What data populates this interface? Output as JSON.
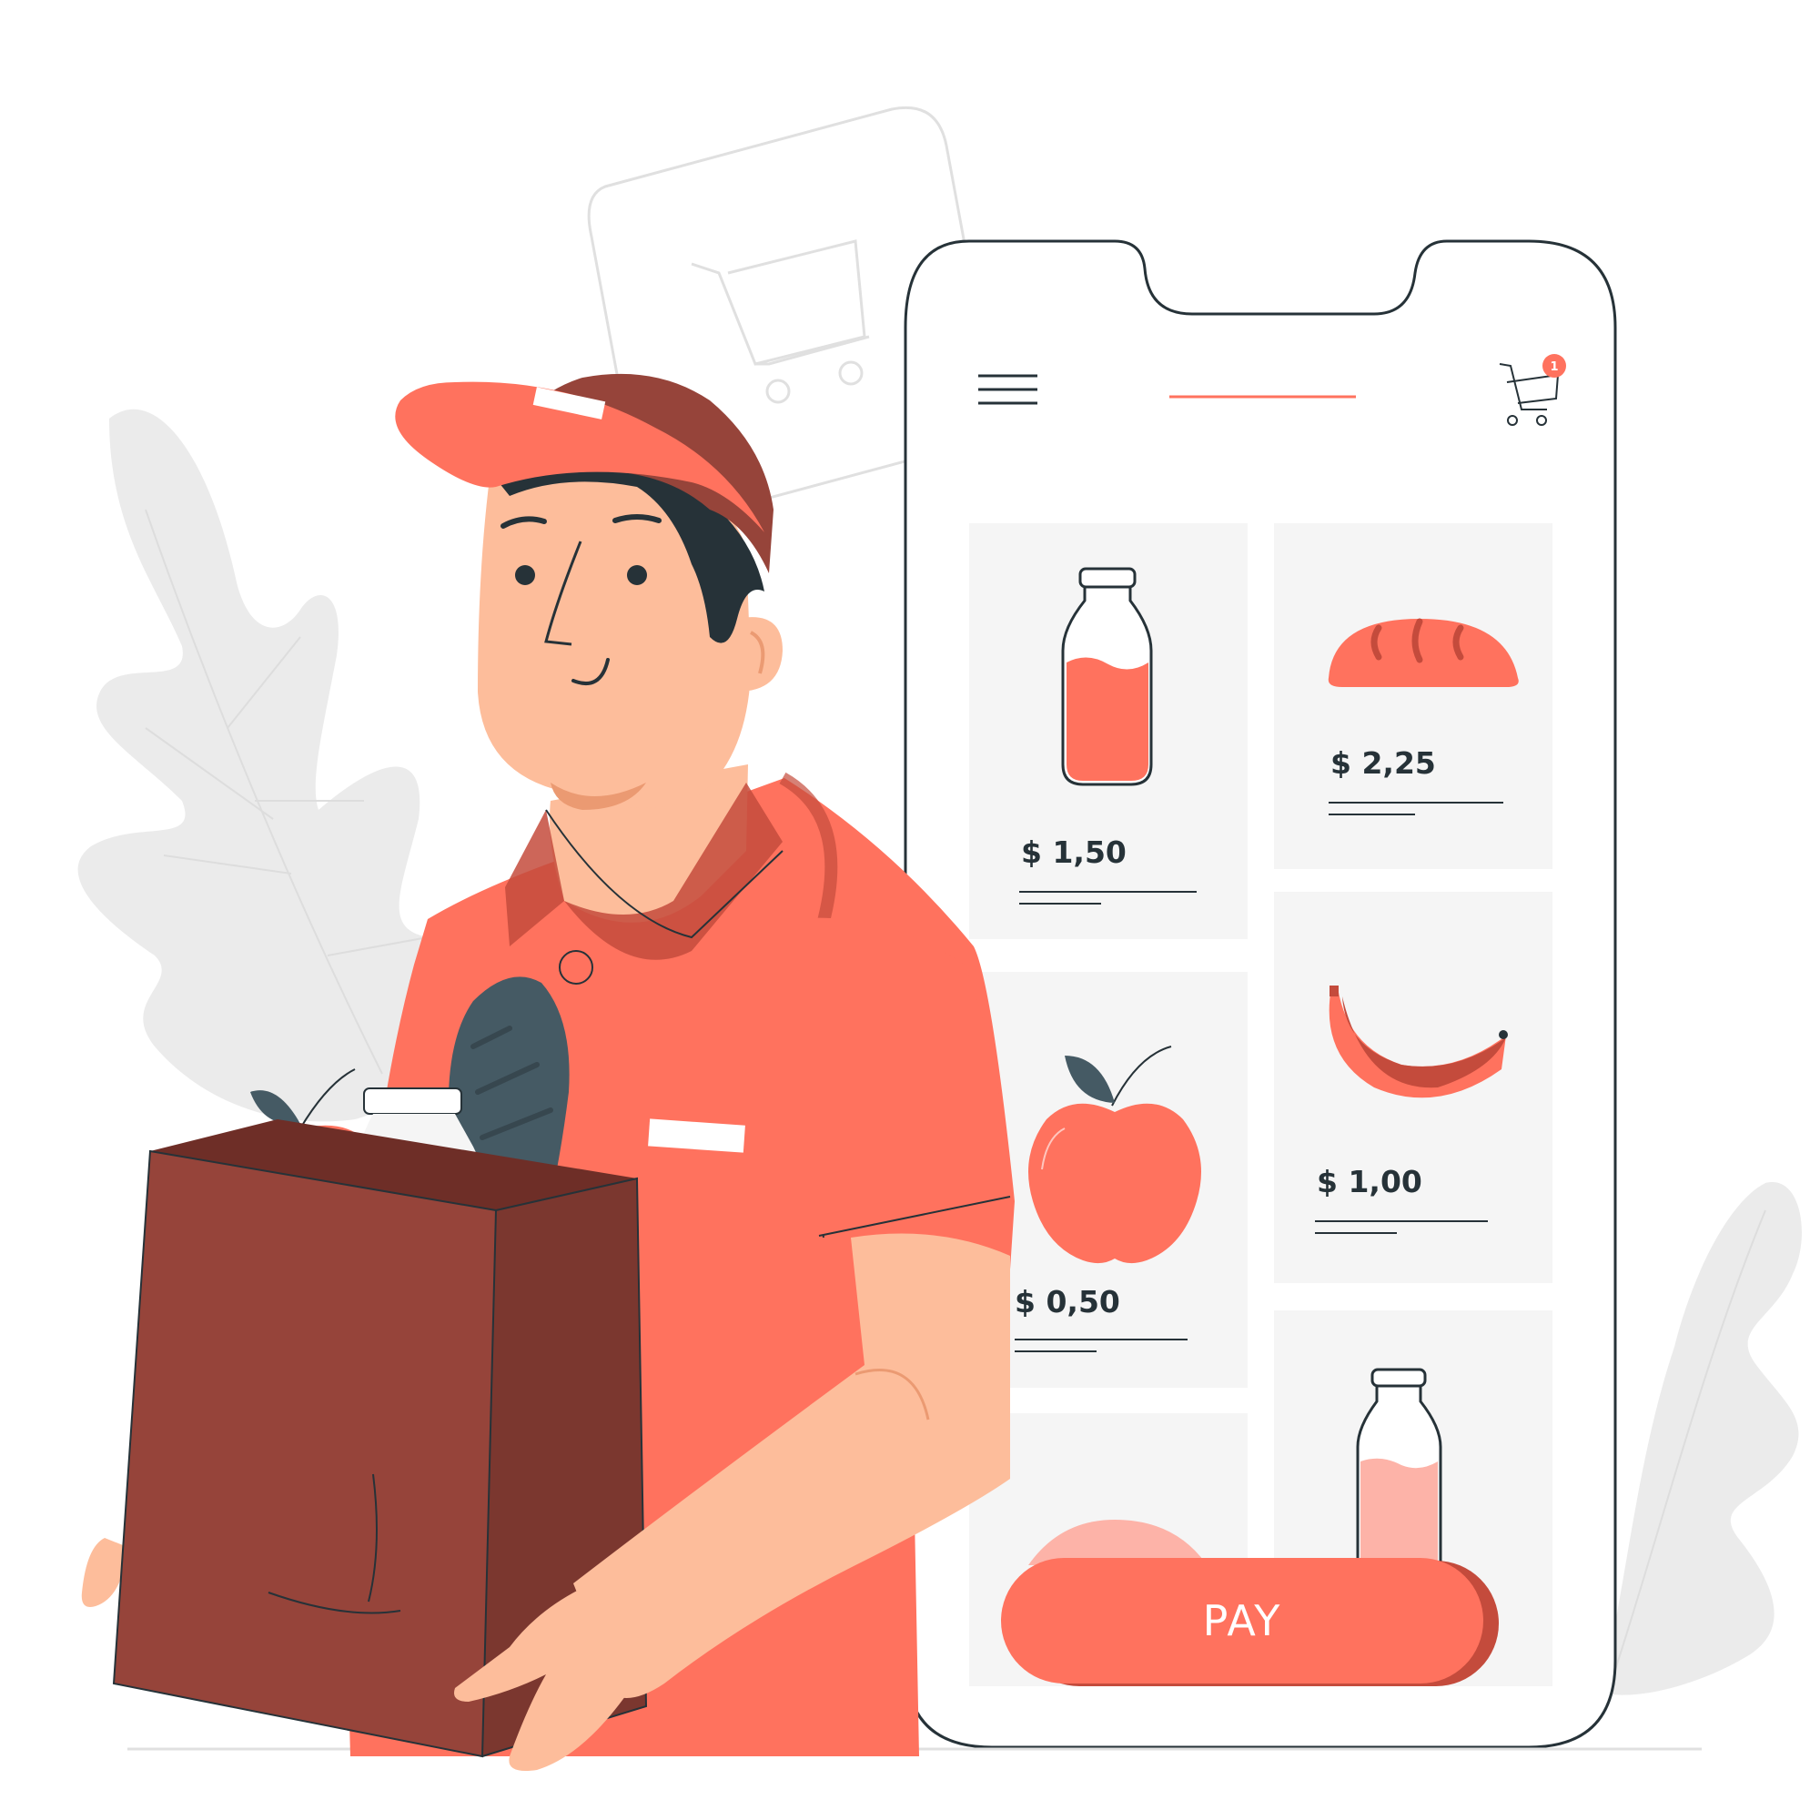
{
  "app": {
    "cart": {
      "badge_count": "1"
    },
    "products": [
      {
        "name": "bottle",
        "price": "$ 1,50"
      },
      {
        "name": "bread",
        "price": "$ 2,25"
      },
      {
        "name": "apple",
        "price": "$ 0,50"
      },
      {
        "name": "banana",
        "price": "$ 1,00"
      }
    ],
    "pay_button_label": "PAY"
  },
  "colors": {
    "accent": "#FF725E",
    "accent_dark": "#C44B3C",
    "bag_brown": "#96443A",
    "skin": "#FDBD9B",
    "hair": "#263238",
    "card_bg": "#F5F5F5",
    "leaf_gray": "#EBEBEB"
  }
}
